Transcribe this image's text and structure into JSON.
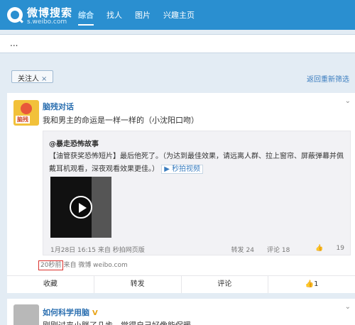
{
  "header": {
    "logo_title": "微博搜索",
    "logo_sub": "s.weibo.com",
    "nav": [
      "综合",
      "找人",
      "图片",
      "兴趣主页"
    ]
  },
  "search": {
    "value": "..."
  },
  "filter": {
    "tag": "关注人",
    "tag_close": "×",
    "back_link": "返回重新筛选"
  },
  "post1": {
    "author": "脑残对话",
    "avatar_badge": "脑残",
    "text": "我和男主的命运是一样一样的（小沈阳口吻）",
    "repost": {
      "author": "@暴走恐怖故事",
      "text": "【油管获奖恐怖短片】最后他死了。（为达到最佳效果，请远离人群、拉上窗帘、屏蔽弹幕并佩戴耳机观看，深夜观看效果更佳。）",
      "video_link": "秒拍视频",
      "meta": "1月28日 16:15 来自 秒拍网页版",
      "stats": [
        "转发 24",
        "评论 18",
        "19"
      ]
    },
    "time": "20秒前",
    "source": "来自 微博 weibo.com",
    "actions": [
      "收藏",
      "转发",
      "评论",
      "1"
    ]
  },
  "post2": {
    "author": "如何科学用脑",
    "text": "刚刚过来小胖了几步，觉得自己好像能保暖"
  }
}
